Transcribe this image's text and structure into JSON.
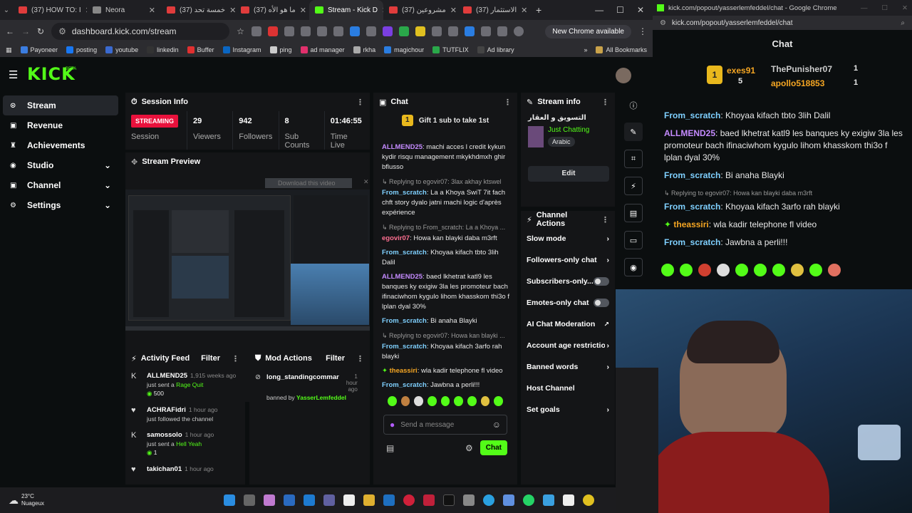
{
  "browser": {
    "tabs": [
      {
        "label": "(37) HOW TO: I",
        "kind": "yt"
      },
      {
        "label": "Neora",
        "kind": "plain"
      },
      {
        "label": "(37) خمسة تحد",
        "kind": "yt"
      },
      {
        "label": "(37) ما هو الأه",
        "kind": "yt"
      },
      {
        "label": "Stream - Kick D",
        "kind": "kick",
        "active": true
      },
      {
        "label": "(37) مشروعين",
        "kind": "yt"
      },
      {
        "label": "(37) الاستثمار",
        "kind": "yt"
      }
    ],
    "url": "dashboard.kick.com/stream",
    "chrome_pill": "New Chrome available",
    "bookmarks": [
      "Payoneer",
      "posting",
      "youtube",
      "linkedin",
      "Buffer",
      "Instagram",
      "ping",
      "ad manager",
      "rkha",
      "magichour",
      "TUTFLIX",
      "Ad library"
    ],
    "all_bookmarks": "All Bookmarks",
    "overflow_label": "»"
  },
  "kick": {
    "logo": "KICK",
    "logo_sup": "BETA",
    "sidebar": [
      {
        "label": "Stream",
        "icon": "dot-icon",
        "active": true
      },
      {
        "label": "Revenue",
        "icon": "square-icon"
      },
      {
        "label": "Achievements",
        "icon": "trophy-icon"
      },
      {
        "label": "Studio",
        "icon": "circle-icon",
        "chevron": true
      },
      {
        "label": "Channel",
        "icon": "square-icon",
        "chevron": true
      },
      {
        "label": "Settings",
        "icon": "gear-icon",
        "chevron": true
      }
    ],
    "session": {
      "title": "Session Info",
      "status": "STREAMING",
      "status_label": "Session",
      "stats": [
        {
          "value": "29",
          "label": "Viewers"
        },
        {
          "value": "942",
          "label": "Followers"
        },
        {
          "value": "8",
          "label": "Sub Counts"
        },
        {
          "value": "01:46:55",
          "label": "Time Live"
        }
      ]
    },
    "preview": {
      "title": "Stream Preview",
      "download": "Download this video"
    },
    "chat": {
      "title": "Chat",
      "gift": "Gift 1 sub to take 1st",
      "gift_rank": "1",
      "messages": [
        {
          "user": "ALLMEND25",
          "color": "#c58bff",
          "text": "machi acces l credit kykun kydir risqu management mkykhdmxh ghir bflusso"
        },
        {
          "reply": "Replying to egovir07: 3lax akhay ktswel",
          "user": "From_scratch",
          "color": "#7fd0ff",
          "text": "La a Khoya SwiT 7it fach chft story dyalo jatni machi logic d'après expérience"
        },
        {
          "reply": "Replying to From_scratch: La a Khoya ...",
          "user": "egovir07",
          "color": "#ff6f91",
          "text": "Howa kan blayki daba m3rft"
        },
        {
          "user": "From_scratch",
          "color": "#7fd0ff",
          "text": "Khoyaa kifach tbto 3lih Dalil"
        },
        {
          "user": "ALLMEND25",
          "color": "#c58bff",
          "text": "baed lkhetrat katl9 les banques ky exigiw 3la les promoteur bach ifinaciwhom kygulo lihom khasskom thi3o f lplan dyal 30%"
        },
        {
          "user": "From_scratch",
          "color": "#7fd0ff",
          "text": "Bi anaha Blayki"
        },
        {
          "reply": "Replying to egovir07: Howa kan blayki ...",
          "user": "From_scratch",
          "color": "#7fd0ff",
          "text": "Khoyaa kifach 3arfo rah blayki"
        },
        {
          "user": "theassiri",
          "color": "#f5a623",
          "text": "wla kadir telephone fl video"
        },
        {
          "user": "From_scratch",
          "color": "#7fd0ff",
          "text": "Jawbna a perli!!!"
        }
      ],
      "placeholder": "Send a message",
      "send": "Chat"
    },
    "stream_info": {
      "title": "Stream info",
      "stream_title": "التسويق و العقار",
      "category": "Just Chatting",
      "tag": "Arabic",
      "edit": "Edit"
    },
    "channel_actions": {
      "title": "Channel Actions",
      "rows": [
        {
          "label": "Slow mode",
          "kind": "chevron"
        },
        {
          "label": "Followers-only chat",
          "kind": "chevron"
        },
        {
          "label": "Subscribers-only...",
          "kind": "toggle"
        },
        {
          "label": "Emotes-only chat",
          "kind": "toggle"
        },
        {
          "label": "AI Chat Moderation",
          "kind": "external"
        },
        {
          "label": "Account age restriction",
          "kind": "chevron"
        },
        {
          "label": "Banned words",
          "kind": "chevron"
        },
        {
          "label": "Host Channel",
          "kind": "none"
        },
        {
          "label": "Set goals",
          "kind": "chevron"
        }
      ]
    },
    "activity": {
      "title": "Activity Feed",
      "filter": "Filter",
      "items": [
        {
          "user": "ALLMEND25",
          "time": "1,915 weeks ago",
          "line": "just sent a",
          "item": "Rage Quit",
          "amount": "500"
        },
        {
          "user": "ACHRAFidri",
          "time": "1 hour ago",
          "line": "just followed the channel"
        },
        {
          "user": "samossolo",
          "time": "1 hour ago",
          "line": "just sent a",
          "item": "Hell Yeah",
          "amount": "1"
        },
        {
          "user": "takichan01",
          "time": "1 hour ago"
        }
      ]
    },
    "mod": {
      "title": "Mod Actions",
      "filter": "Filter",
      "items": [
        {
          "user": "long_standingcommar",
          "time": "1 hour ago",
          "by_label": "banned by",
          "by": "YasserLemfeddel"
        }
      ]
    }
  },
  "popout": {
    "window_title": "kick.com/popout/yasserlemfeddel/chat - Google Chrome",
    "url": "kick.com/popout/yasserlemfeddel/chat",
    "title": "Chat",
    "leaders": [
      {
        "rank": "1",
        "name": "exes91",
        "count": "5"
      },
      {
        "name": "ThePunisher07",
        "count": "1"
      },
      {
        "name": "apollo518853",
        "count": "1"
      }
    ],
    "messages": [
      {
        "user": "From_scratch",
        "color": "#7fd0ff",
        "text": "Khoyaa kifach tbto 3lih Dalil"
      },
      {
        "user": "ALLMEND25",
        "color": "#c58bff",
        "text": "baed lkhetrat katl9 les banques ky exigiw 3la les promoteur bach ifinaciwhom kygulo lihom khasskom thi3o f lplan dyal 30%"
      },
      {
        "user": "From_scratch",
        "color": "#7fd0ff",
        "text": "Bi anaha Blayki"
      },
      {
        "reply": "Replying to egovir07: Howa kan blayki daba m3rft",
        "user": "From_scratch",
        "color": "#7fd0ff",
        "text": "Khoyaa kifach 3arfo rah blayki"
      },
      {
        "user": "theassiri",
        "color": "#f5a623",
        "text": "wla kadir telephone fl video"
      },
      {
        "user": "From_scratch",
        "color": "#7fd0ff",
        "text": "Jawbna a perli!!!"
      }
    ]
  },
  "taskbar": {
    "temp": "23°C",
    "weather": "Nuageux"
  },
  "colors": {
    "accent": "#53fc18",
    "live": "#e9113c"
  }
}
